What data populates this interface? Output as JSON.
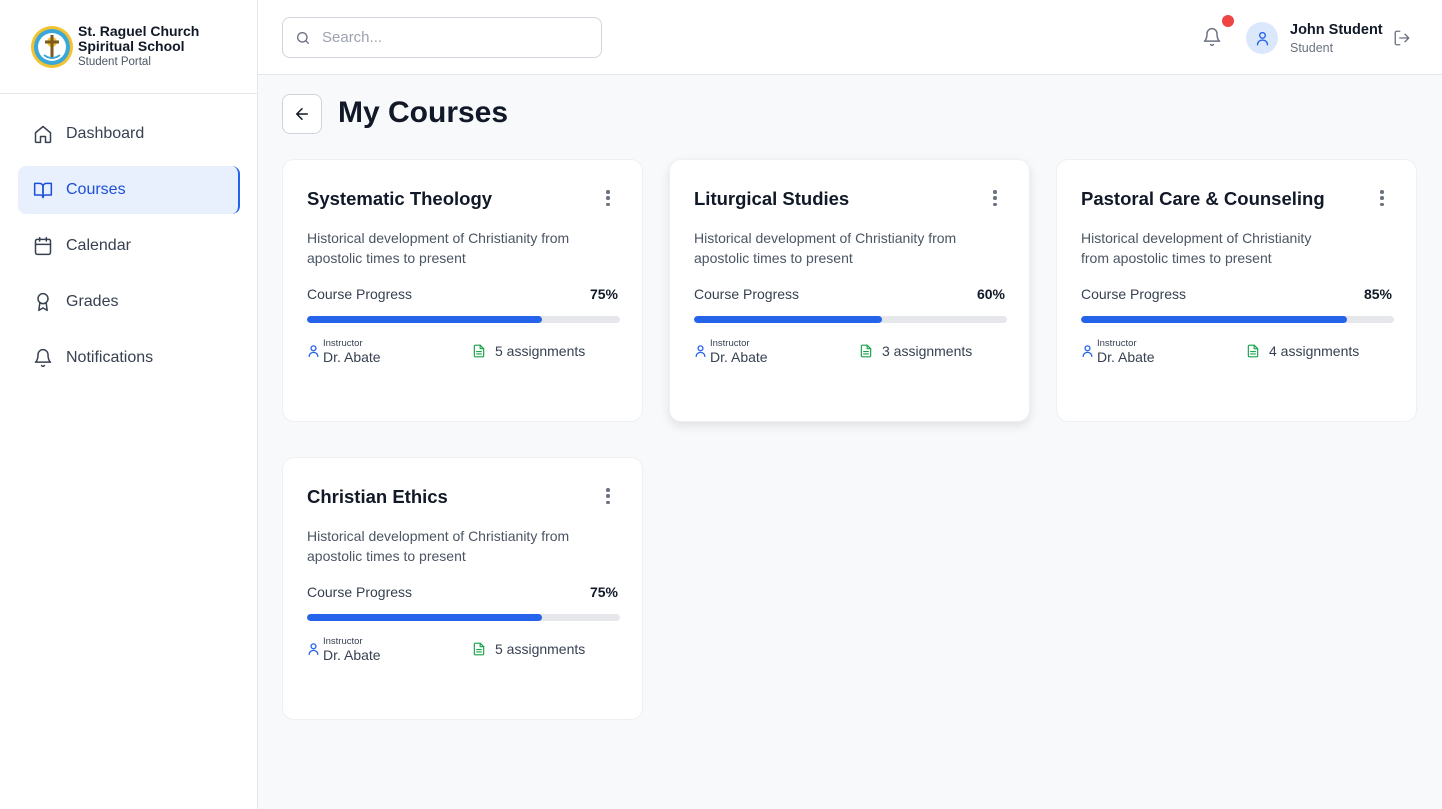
{
  "brand": {
    "line1": "St. Raguel  Church",
    "line2": "Spiritual School",
    "subtitle": "Student Portal"
  },
  "nav": {
    "items": [
      {
        "label": "Dashboard",
        "icon": "home-icon",
        "active": false
      },
      {
        "label": "Courses",
        "icon": "book-open-icon",
        "active": true
      },
      {
        "label": "Calendar",
        "icon": "calendar-icon",
        "active": false
      },
      {
        "label": "Grades",
        "icon": "award-icon",
        "active": false
      },
      {
        "label": "Notifications",
        "icon": "bell-icon",
        "active": false
      }
    ]
  },
  "search": {
    "placeholder": "Search...",
    "value": ""
  },
  "user": {
    "name": "John Student",
    "role": "Student",
    "has_unread_notifications": true
  },
  "page": {
    "title": "My Courses"
  },
  "colors": {
    "accent": "#2563eb",
    "active_bg": "#e8f0fd",
    "notification_dot": "#ef4444",
    "assignment_icon": "#16a34a"
  },
  "courses": [
    {
      "title": "Systematic Theology",
      "description": "Historical development of Christianity from apostolic times to present",
      "progress_label": "Course Progress",
      "progress": 75,
      "progress_text": "75%",
      "instructor_label": "Instructor",
      "instructor": "Dr. Abate",
      "assignments": "5 assignments"
    },
    {
      "title": "Liturgical Studies",
      "description": "Historical development of Christianity from apostolic times to present",
      "progress_label": "Course Progress",
      "progress": 60,
      "progress_text": "60%",
      "instructor_label": "Instructor",
      "instructor": "Dr. Abate",
      "assignments": "3 assignments"
    },
    {
      "title": "Pastoral Care & Counseling",
      "description": "Historical development of Christianity from apostolic times to present",
      "progress_label": "Course Progress",
      "progress": 85,
      "progress_text": "85%",
      "instructor_label": "Instructor",
      "instructor": "Dr. Abate",
      "assignments": "4 assignments"
    },
    {
      "title": "Christian Ethics",
      "description": "Historical development of Christianity from apostolic times to present",
      "progress_label": "Course Progress",
      "progress": 75,
      "progress_text": "75%",
      "instructor_label": "Instructor",
      "instructor": "Dr. Abate",
      "assignments": "5 assignments"
    }
  ]
}
